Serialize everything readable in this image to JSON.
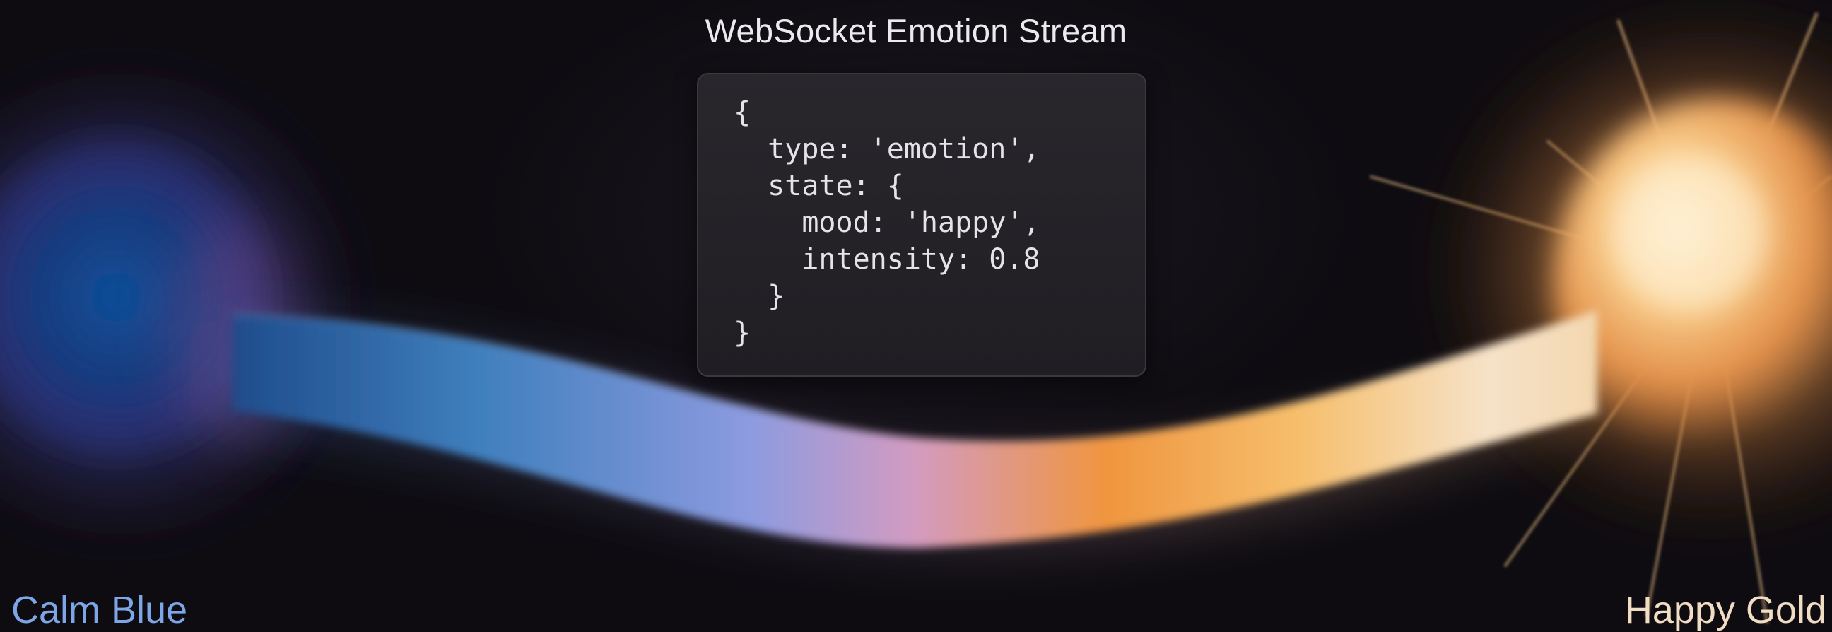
{
  "title": "WebSocket Emotion Stream",
  "code_lines": [
    "{",
    "  type: 'emotion',",
    "  state: {",
    "    mood: 'happy',",
    "    intensity: 0.8",
    "  }",
    "}"
  ],
  "left_state": {
    "label": "Calm Blue",
    "color": "#7da6e6"
  },
  "right_state": {
    "label": "Happy Gold",
    "color": "#f1ddc3"
  },
  "ribbon_colors": [
    "#3f7fbd",
    "#8d9be0",
    "#d39bc0",
    "#f0953f",
    "#f6be6b",
    "#f6e2c8"
  ]
}
